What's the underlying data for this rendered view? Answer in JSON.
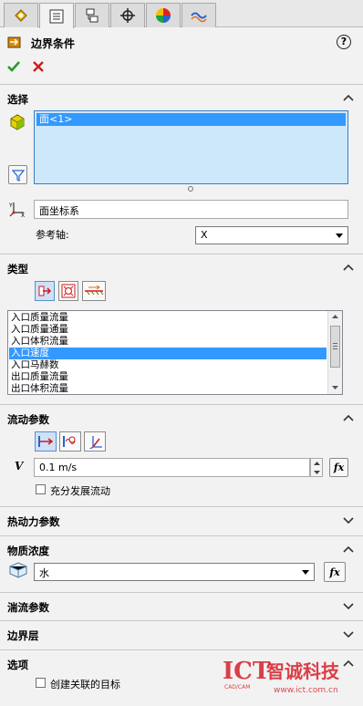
{
  "tabs": [
    {
      "icon": "feature-manager-icon"
    },
    {
      "icon": "property-manager-icon"
    },
    {
      "icon": "configuration-manager-icon"
    },
    {
      "icon": "dimxpert-icon"
    },
    {
      "icon": "display-manager-icon"
    },
    {
      "icon": "flow-analysis-tree-icon"
    }
  ],
  "panel": {
    "title": "边界条件",
    "help_label": "?"
  },
  "selection": {
    "header": "选择",
    "items": [
      "面<1>"
    ],
    "coord_value": "面坐标系",
    "axis_label": "参考轴:",
    "axis_value": "X"
  },
  "type": {
    "header": "类型",
    "items": [
      "入口质量流量",
      "入口质量通量",
      "入口体积流量",
      "入口速度",
      "入口马赫数",
      "出口质量流量",
      "出口体积流量"
    ],
    "selected": "入口速度"
  },
  "flow": {
    "header": "流动参数",
    "v_label": "V",
    "v_value": "0.1 m/s",
    "fully_developed_label": "充分发展流动",
    "fx_label": "fx"
  },
  "sections": {
    "thermo": "热动力参数",
    "substance": "物质浓度",
    "turbulence": "湍流参数",
    "boundary_layer": "边界层",
    "options": "选项"
  },
  "substance": {
    "value": "水",
    "fx_label": "fx"
  },
  "options": {
    "create_goal_label": "创建关联的目标"
  },
  "watermark": {
    "brand": "ICT",
    "sub": "CAD/CAM",
    "company": "智诚科技",
    "url": "www.ict.com.cn"
  },
  "colors": {
    "selection_blue": "#3399ff",
    "list_bg": "#cde8fa",
    "accept": "#2c9a2c",
    "cancel": "#d11a1a",
    "watermark_red": "#d6202a"
  }
}
